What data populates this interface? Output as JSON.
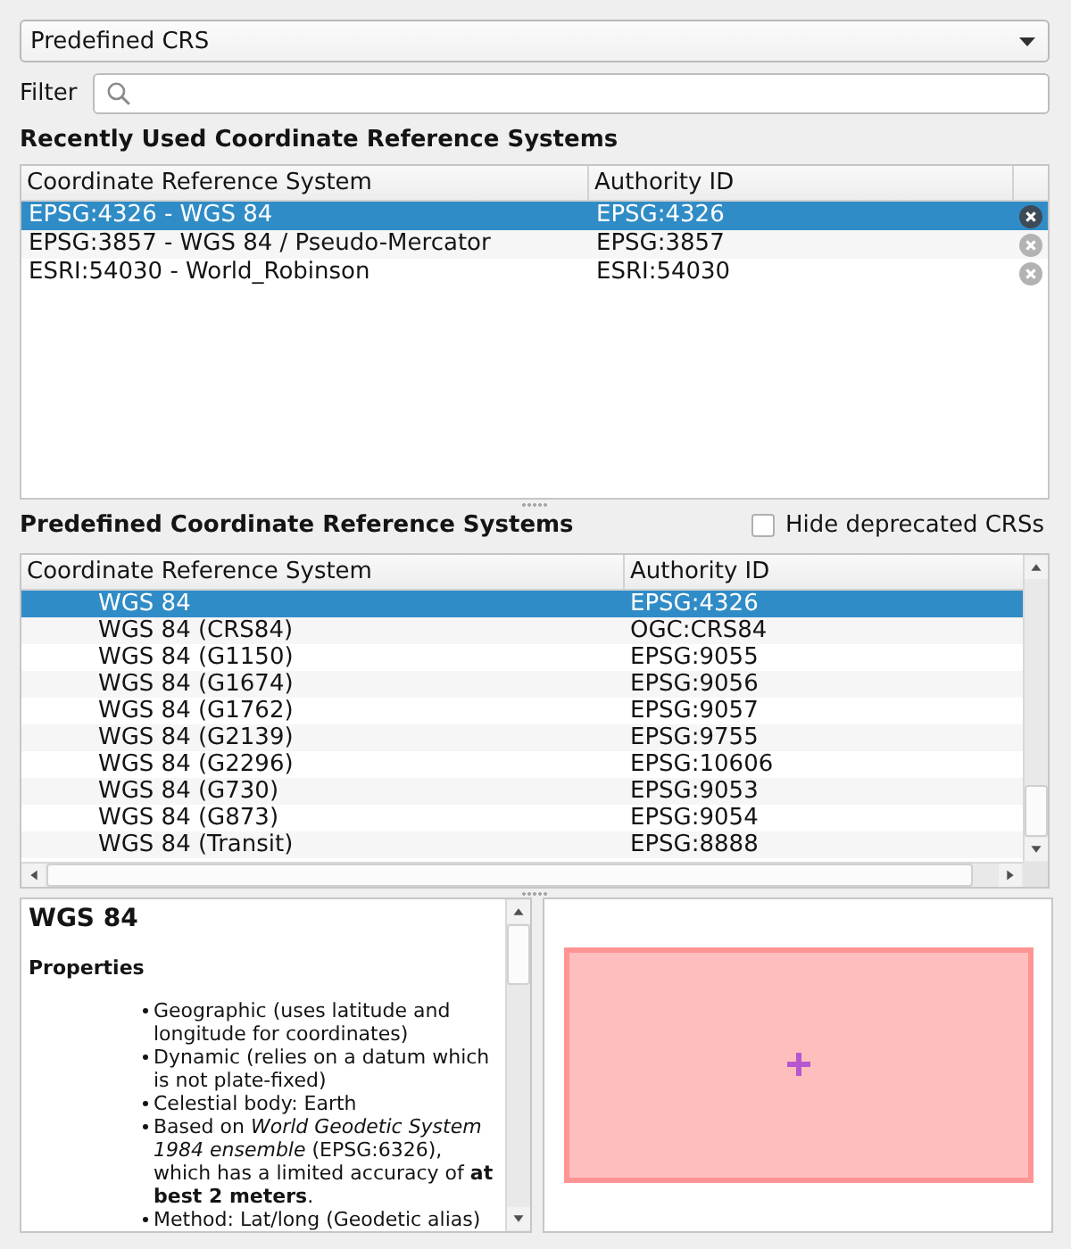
{
  "crs_type": {
    "value": "Predefined CRS"
  },
  "filter": {
    "label": "Filter"
  },
  "recent": {
    "title": "Recently Used Coordinate Reference Systems",
    "columns": [
      "Coordinate Reference System",
      "Authority ID"
    ],
    "rows": [
      {
        "crs": "EPSG:4326 - WGS 84",
        "authority_id": "EPSG:4326",
        "selected": true
      },
      {
        "crs": "EPSG:3857 - WGS 84 / Pseudo-Mercator",
        "authority_id": "EPSG:3857",
        "selected": false
      },
      {
        "crs": "ESRI:54030 - World_Robinson",
        "authority_id": "ESRI:54030",
        "selected": false
      }
    ]
  },
  "predefined": {
    "title": "Predefined Coordinate Reference Systems",
    "hide_deprecated": {
      "label": "Hide deprecated CRSs",
      "checked": false
    },
    "columns": [
      "Coordinate Reference System",
      "Authority ID"
    ],
    "rows": [
      {
        "crs": "WGS 84",
        "authority_id": "EPSG:4326",
        "selected": true
      },
      {
        "crs": "WGS 84 (CRS84)",
        "authority_id": "OGC:CRS84",
        "selected": false
      },
      {
        "crs": "WGS 84 (G1150)",
        "authority_id": "EPSG:9055",
        "selected": false
      },
      {
        "crs": "WGS 84 (G1674)",
        "authority_id": "EPSG:9056",
        "selected": false
      },
      {
        "crs": "WGS 84 (G1762)",
        "authority_id": "EPSG:9057",
        "selected": false
      },
      {
        "crs": "WGS 84 (G2139)",
        "authority_id": "EPSG:9755",
        "selected": false
      },
      {
        "crs": "WGS 84 (G2296)",
        "authority_id": "EPSG:10606",
        "selected": false
      },
      {
        "crs": "WGS 84 (G730)",
        "authority_id": "EPSG:9053",
        "selected": false
      },
      {
        "crs": "WGS 84 (G873)",
        "authority_id": "EPSG:9054",
        "selected": false
      },
      {
        "crs": "WGS 84 (Transit)",
        "authority_id": "EPSG:8888",
        "selected": false
      }
    ]
  },
  "details": {
    "title": "WGS 84",
    "heading": "Properties",
    "items": [
      "Geographic (uses latitude and longitude for coordinates)",
      "Dynamic (relies on a datum which is not plate-fixed)",
      "Celestial body: Earth",
      "Based on *World Geodetic System 1984 ensemble* (EPSG:6326), which has a limited accuracy of **at best 2 meters**.",
      "Method: Lat/long (Geodetic alias)"
    ]
  }
}
